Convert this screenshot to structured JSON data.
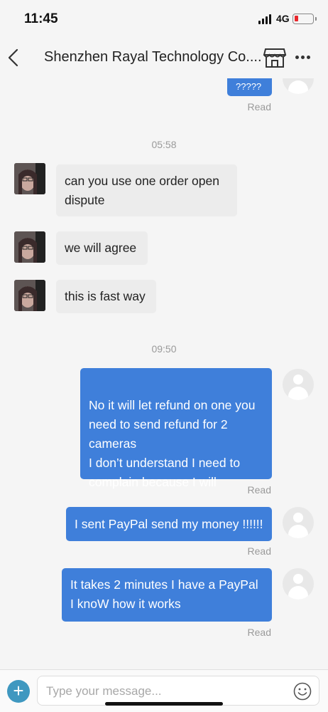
{
  "status_bar": {
    "time": "11:45",
    "network": "4G"
  },
  "header": {
    "title": "Shenzhen Rayal Technology Co...."
  },
  "messages": {
    "partial_top": "?????",
    "ts1": "05:58",
    "in1": "can you use one order open dispute",
    "in2": "we will agree",
    "in3": "this is fast way",
    "ts2": "09:50",
    "out1": "No it will let refund on one you need to send refund for 2 cameras\nI don’t understand I need to complain because I will",
    "out2": "I sent PayPal send my money !!!!!!",
    "out3": "It takes 2 minutes I have a PayPal I knoW how it works",
    "read_label": "Read"
  },
  "input_bar": {
    "placeholder": "Type your message..."
  }
}
